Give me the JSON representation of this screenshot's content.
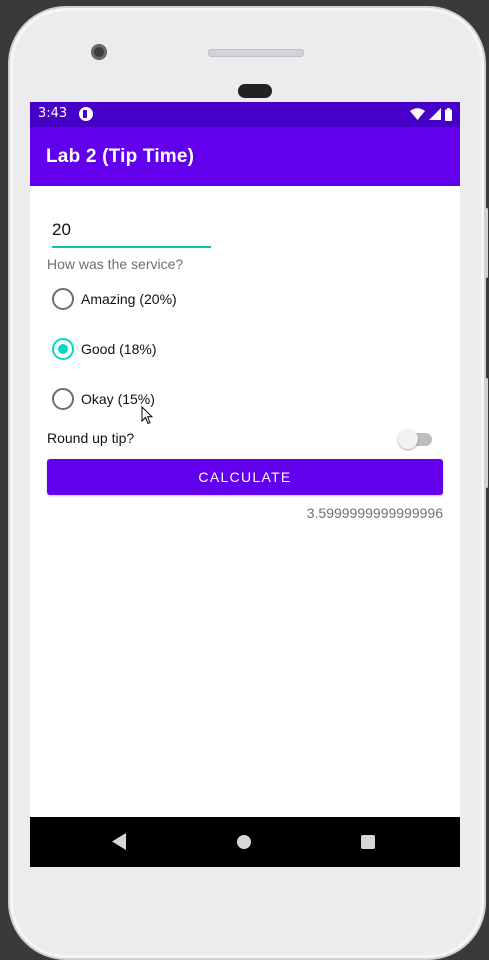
{
  "status_bar": {
    "time": "3:43",
    "icons": [
      "notification-app-icon",
      "wifi-icon",
      "signal-icon",
      "battery-icon"
    ]
  },
  "app_bar": {
    "title": "Lab 2 (Tip Time)"
  },
  "form": {
    "cost_value": "20",
    "service_question": "How was the service?",
    "options": [
      {
        "label": "Amazing (20%)",
        "checked": false
      },
      {
        "label": "Good (18%)",
        "checked": true
      },
      {
        "label": "Okay (15%)",
        "checked": false
      }
    ],
    "round_up_label": "Round up tip?",
    "round_up_on": false,
    "calculate_label": "CALCULATE",
    "result": "3.5999999999999996"
  },
  "colors": {
    "primary": "#6200ee",
    "primary_dark": "#4700c8",
    "accent": "#03dac5"
  },
  "nav": {
    "icons": [
      "back-icon",
      "home-icon",
      "recents-icon"
    ]
  }
}
